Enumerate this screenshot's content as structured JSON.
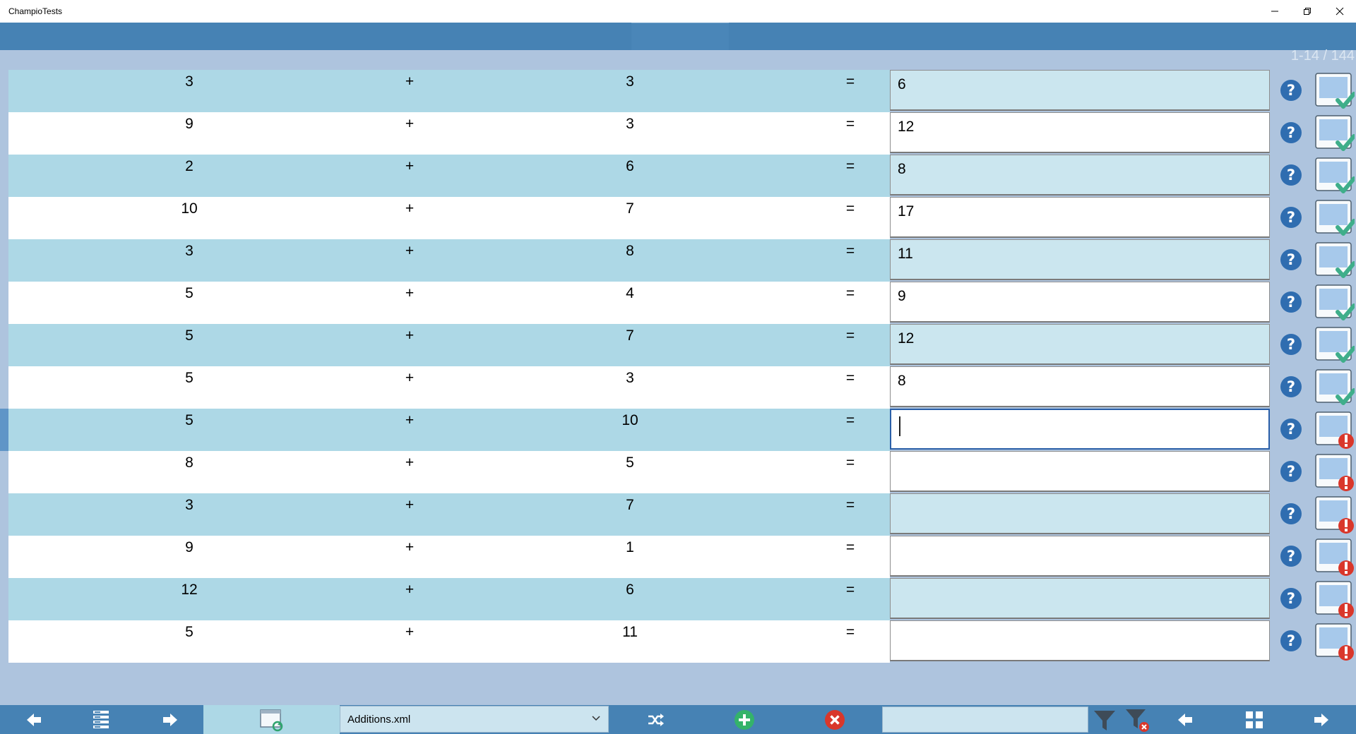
{
  "window": {
    "title": "ChampioTests",
    "controls": [
      "minimize",
      "restore",
      "close"
    ]
  },
  "header": {
    "range_label": "1-14 / 144"
  },
  "operator_symbol": "+",
  "equals_symbol": "=",
  "rows": [
    {
      "a": "3",
      "b": "3",
      "answer": "6",
      "status": "correct"
    },
    {
      "a": "9",
      "b": "3",
      "answer": "12",
      "status": "correct"
    },
    {
      "a": "2",
      "b": "6",
      "answer": "8",
      "status": "correct"
    },
    {
      "a": "10",
      "b": "7",
      "answer": "17",
      "status": "correct"
    },
    {
      "a": "3",
      "b": "8",
      "answer": "11",
      "status": "correct"
    },
    {
      "a": "5",
      "b": "4",
      "answer": "9",
      "status": "correct"
    },
    {
      "a": "5",
      "b": "7",
      "answer": "12",
      "status": "correct"
    },
    {
      "a": "5",
      "b": "3",
      "answer": "8",
      "status": "correct"
    },
    {
      "a": "5",
      "b": "10",
      "answer": "",
      "status": "error",
      "focused": true
    },
    {
      "a": "8",
      "b": "5",
      "answer": "",
      "status": "error"
    },
    {
      "a": "3",
      "b": "7",
      "answer": "",
      "status": "error"
    },
    {
      "a": "9",
      "b": "1",
      "answer": "",
      "status": "error"
    },
    {
      "a": "12",
      "b": "6",
      "answer": "",
      "status": "error"
    },
    {
      "a": "5",
      "b": "11",
      "answer": "",
      "status": "error"
    }
  ],
  "toolbar": {
    "file_selected": "Additions.xml",
    "search_value": "",
    "icons": [
      "arrow-left-icon",
      "list-icon",
      "arrow-right-icon",
      "window-refresh-icon",
      "shuffle-icon",
      "add-icon",
      "delete-icon",
      "filter-icon",
      "clear-filter-icon",
      "page-left-icon",
      "grid-icon",
      "page-right-icon"
    ]
  },
  "colors": {
    "header": "#4682b4",
    "row_odd": "#add8e6",
    "row_even": "#ffffff",
    "background": "#aec4de",
    "correct": "#3fae8a",
    "error": "#d9372b",
    "help": "#2f6db0"
  }
}
